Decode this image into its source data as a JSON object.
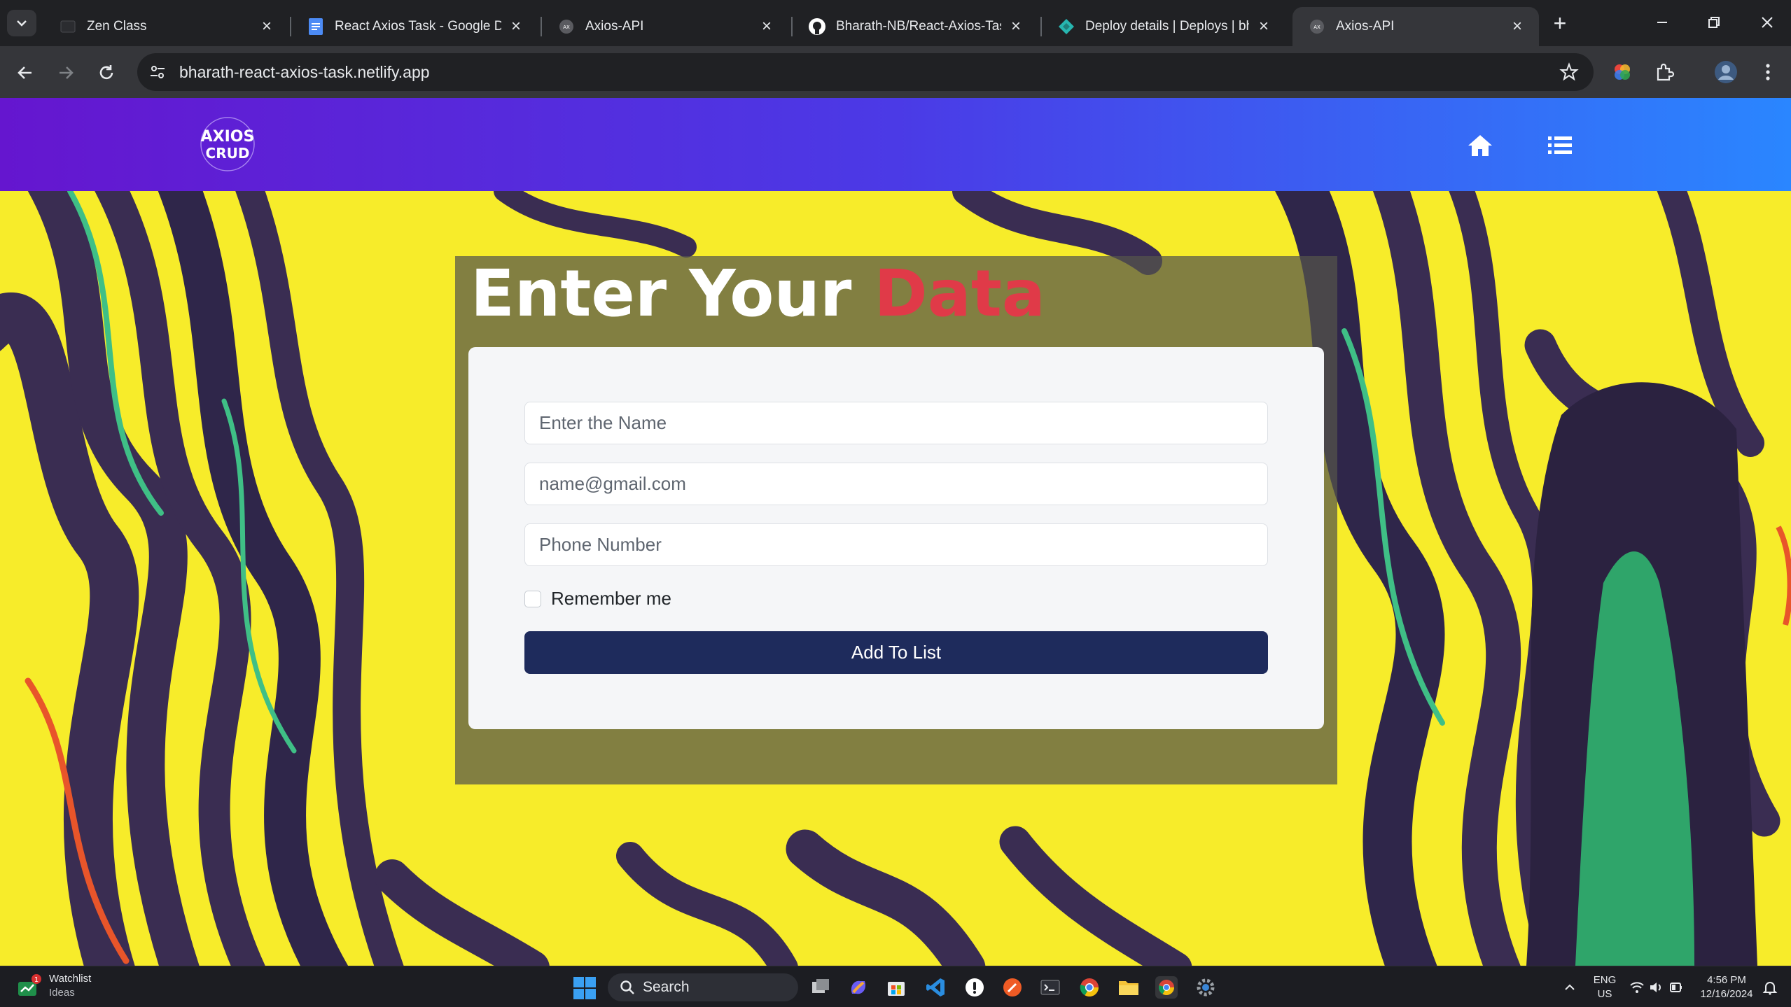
{
  "browser": {
    "tabs": [
      {
        "title": "Zen Class",
        "active": false
      },
      {
        "title": "React Axios Task - Google Doc",
        "active": false
      },
      {
        "title": "Axios-API",
        "active": false
      },
      {
        "title": "Bharath-NB/React-Axios-Task",
        "active": false
      },
      {
        "title": "Deploy details | Deploys | bha",
        "active": false
      },
      {
        "title": "Axios-API",
        "active": true
      }
    ],
    "url": "bharath-react-axios-task.netlify.app"
  },
  "app": {
    "logo_line1": "AXIOS",
    "logo_line2": "CRUD",
    "nav_icons": [
      "home-icon",
      "list-icon"
    ]
  },
  "form": {
    "heading_white": "Enter Your",
    "heading_red": "Data",
    "name_placeholder": "Enter the Name",
    "email_placeholder": "name@gmail.com",
    "phone_placeholder": "Phone Number",
    "remember_label": "Remember me",
    "submit_label": "Add To List",
    "colors": {
      "accent_red": "#e03a48",
      "button": "#1e2b5c"
    }
  },
  "taskbar": {
    "weather_title": "Watchlist",
    "weather_sub": "Ideas",
    "weather_badge": "1",
    "search_label": "Search",
    "lang_top": "ENG",
    "lang_bottom": "US",
    "time": "4:56 PM",
    "date": "12/16/2024"
  }
}
